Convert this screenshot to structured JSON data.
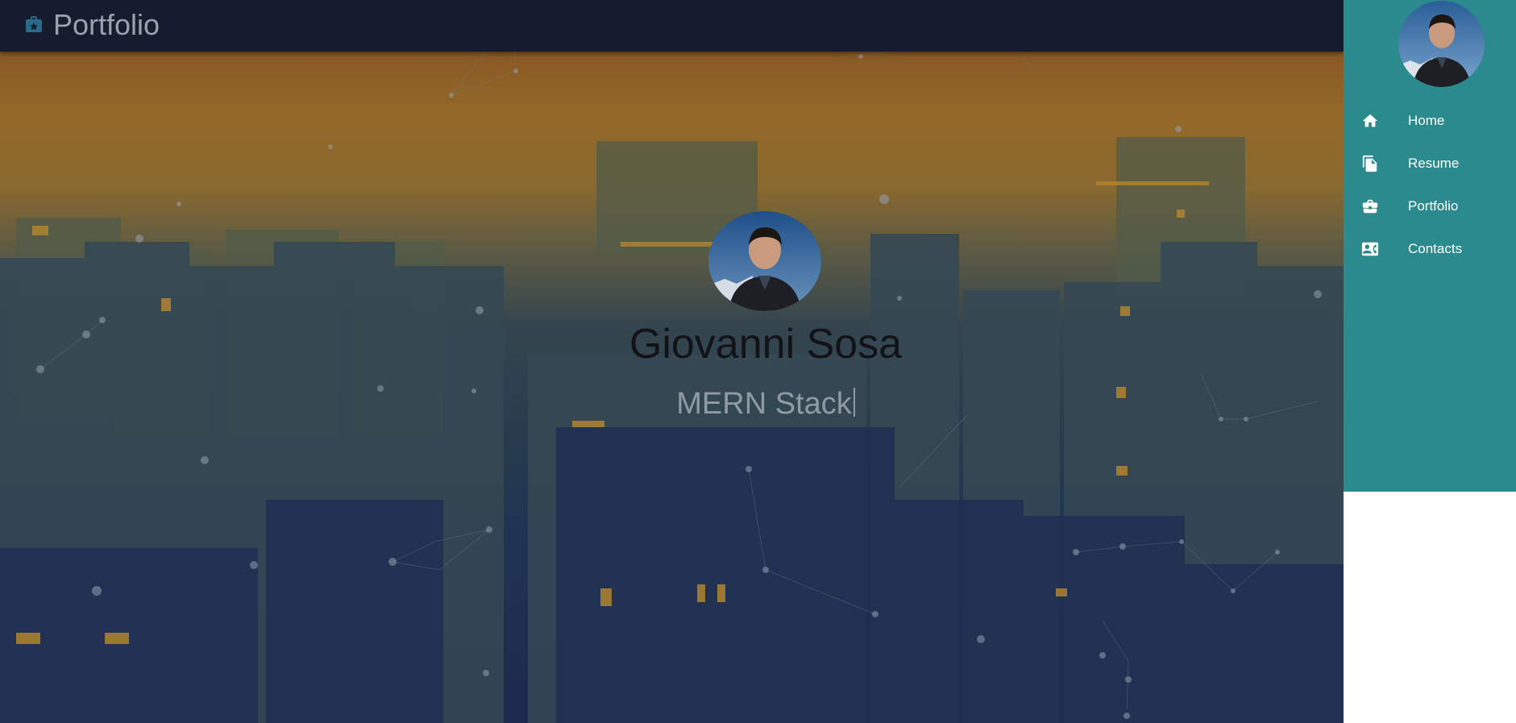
{
  "header": {
    "title": "Portfolio",
    "icon": "portfolio-icon"
  },
  "profile": {
    "name": "Giovanni Sosa",
    "role": "MERN Stack"
  },
  "sidebar": {
    "items": [
      {
        "label": "Home",
        "icon": "home-icon"
      },
      {
        "label": "Resume",
        "icon": "file-copy-icon"
      },
      {
        "label": "Portfolio",
        "icon": "briefcase-icon"
      },
      {
        "label": "Contacts",
        "icon": "contact-card-icon"
      }
    ]
  },
  "colors": {
    "sidebar": "#2a8a8e",
    "topbar": "#151c2e",
    "accent": "#2a8a8e"
  }
}
